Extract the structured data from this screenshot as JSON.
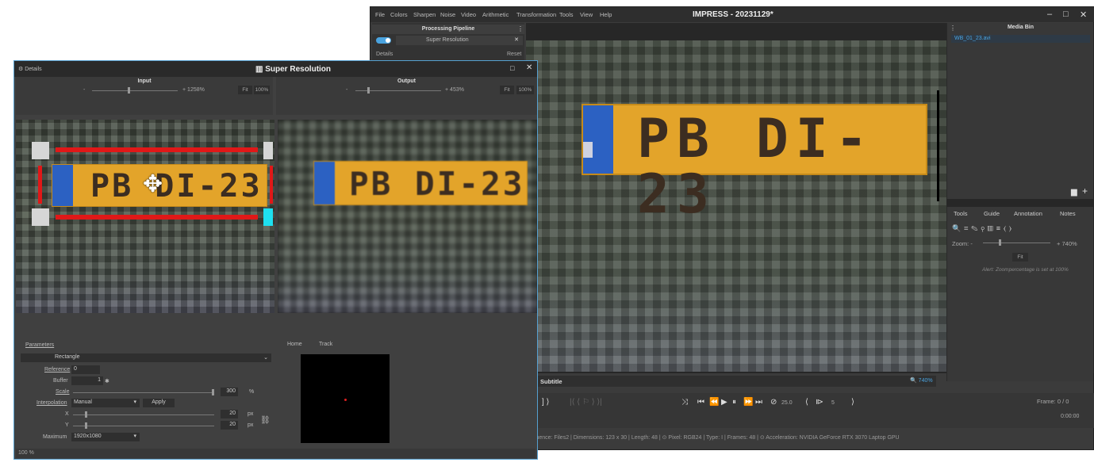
{
  "main": {
    "menu": [
      "File",
      "Colors",
      "Sharpen",
      "Noise",
      "Video",
      "Arithmetic",
      "Transformation",
      "Tools",
      "View",
      "Help"
    ],
    "title": "IMPRESS - 20231129*",
    "window_controls": [
      "–",
      "□",
      "✕"
    ],
    "pipeline": {
      "header": "Processing Pipeline",
      "item": "Super Resolution",
      "details_label": "Details",
      "reset_label": "Reset"
    },
    "plate_text": "PB DI-23",
    "subtitle_label": "Subtitle",
    "zoom_chip": "740%",
    "media_bin": {
      "header": "Media Bin",
      "item": "WB_01_23.avi"
    },
    "tool_tabs": [
      "Tools",
      "Guide",
      "Annotation",
      "Notes"
    ],
    "zoom_label": "Zoom:",
    "zoom_minus": "-",
    "zoom_plus": "+",
    "zoom_value": "740%",
    "fit_label": "Fit",
    "alert": "Alert: Zoompercentage is set at 100%",
    "frame_label": "Frame:",
    "frame_value": "0 / 0",
    "timecode": "0:00:00",
    "fps": "25.0",
    "step": "5",
    "status": "Sequence: Files2  |  Dimensions: 123 x 30  |  Length: 48  |  ⊙ Pixel: RGB24  |  Type: I  |  Frames: 48  |  ⊙ Acceleration: NVIDIA GeForce RTX 3070 Laptop GPU"
  },
  "details": {
    "window_label": "Details",
    "title": "Super Resolution",
    "input": {
      "header": "Input",
      "minus": "-",
      "plus": "+",
      "zoom": "1258%",
      "fit": "Fit",
      "hundred": "100%"
    },
    "output": {
      "header": "Output",
      "minus": "-",
      "plus": "+",
      "zoom": "453%",
      "fit": "Fit",
      "hundred": "100%"
    },
    "parameters_label": "Parameters",
    "shape": "Rectangle",
    "reference_label": "Reference",
    "reference_value": "0",
    "buffer_label": "Buffer",
    "buffer_value": "1",
    "scale_label": "Scale",
    "scale_value": "300",
    "scale_unit": "%",
    "interpolation_label": "Interpolation",
    "interpolation_value": "Manual",
    "apply_label": "Apply",
    "x_label": "X",
    "x_value": "20",
    "y_label": "Y",
    "y_value": "20",
    "px_unit": "px",
    "maximum_label": "Maximum",
    "maximum_value": "1920x1080",
    "tab_home": "Home",
    "tab_track": "Track",
    "status_zoom": "100 %"
  }
}
